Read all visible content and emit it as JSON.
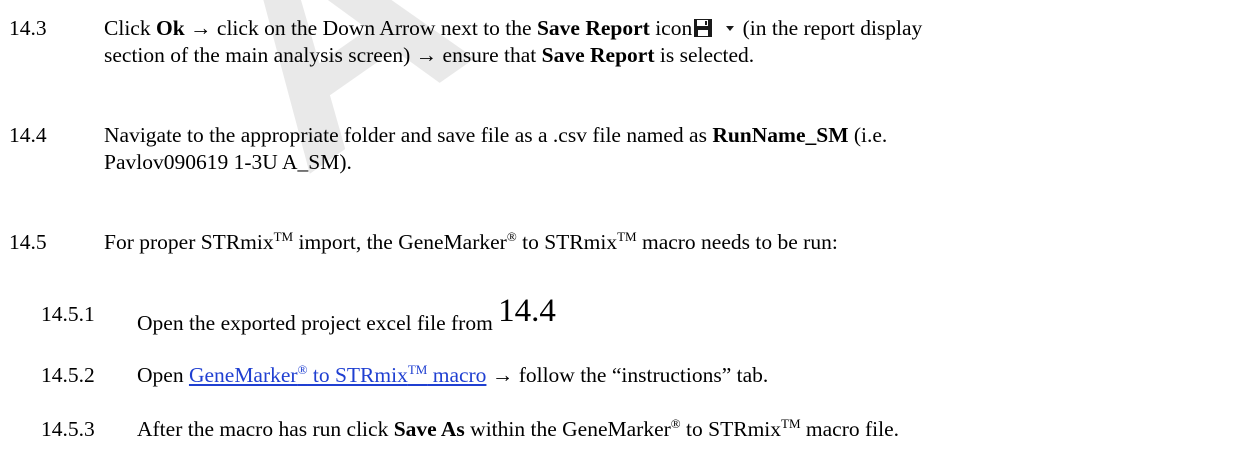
{
  "watermark": "A",
  "steps": [
    {
      "num": "14.3",
      "l1_a": "Click ",
      "l1_ok": "Ok",
      "l1_b": " → click on the Down Arrow next to the ",
      "l1_save_report": "Save Report",
      "l1_c": " icon",
      "l1_d": " (in the report display",
      "l2_a": "section of the main analysis screen) → ensure that ",
      "l2_save_report": "Save Report",
      "l2_b": " is selected."
    },
    {
      "num": "14.4",
      "l1_a": "Navigate to the appropriate folder and save file as a .csv file named as ",
      "l1_name": "RunName_SM",
      "l1_b": " (i.e.",
      "l2": "Pavlov090619 1-3U A_SM)."
    },
    {
      "num": "14.5",
      "a": "For proper STRmix",
      "tm1": "TM",
      "b": " import, the GeneMarker",
      "reg": "®",
      "c": " to STRmix",
      "tm2": "TM",
      "d": " macro needs to be run:"
    }
  ],
  "substeps": [
    {
      "num": "14.5.1",
      "a": "Open the exported project excel file from ",
      "ref": "14.4"
    },
    {
      "num": "14.5.2",
      "a": "Open ",
      "link_a": "GeneMarker",
      "link_reg": "®",
      "link_b": " to STRmix",
      "link_tm": "TM",
      "link_c": " macro",
      "b": " → follow the “instructions” tab."
    },
    {
      "num": "14.5.3",
      "a": "After the macro has run click ",
      "bold": "Save As",
      "b": " within the GeneMarker",
      "reg": "®",
      "c": " to STRmix",
      "tm": "TM",
      "d": " macro file."
    }
  ],
  "icons": [
    "save-floppy-icon",
    "dropdown-arrow-icon"
  ]
}
